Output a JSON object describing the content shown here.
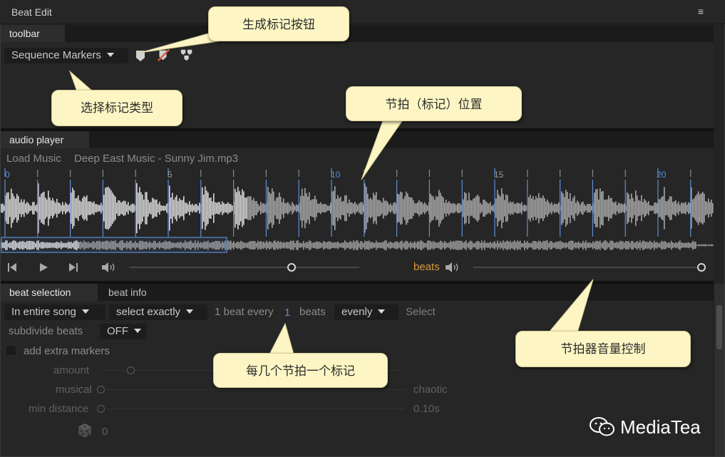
{
  "window": {
    "title": "Beat Edit",
    "menu_icon": "hamburger-icon"
  },
  "toolbar_panel": {
    "tab": "toolbar",
    "marker_type_value": "Sequence Markers",
    "buttons": [
      "marker-icon",
      "clear-markers-icon",
      "beat-edit-icon"
    ]
  },
  "audio_player": {
    "tab": "audio player",
    "load_music": "Load Music",
    "file_name": "Deep East Music - Sunny Jim.mp3",
    "ruler_labels": [
      "0",
      "5",
      "10",
      "15",
      "20"
    ],
    "beats_label": "beats"
  },
  "beat_selection": {
    "tabs": [
      "beat selection",
      "beat info"
    ],
    "scope_value": "In entire song",
    "mode_value": "select exactly",
    "every_prefix": "1 beat every",
    "every_value": "1",
    "every_suffix": "beats",
    "distribution_value": "evenly",
    "select_label": "Select",
    "subdivide_label": "subdivide beats",
    "subdivide_value": "OFF",
    "extra_markers_label": "add extra markers",
    "amount_label": "amount",
    "musical_label": "musical",
    "chaotic_label": "chaotic",
    "min_distance_label": "min distance",
    "min_distance_value": "0.10s",
    "seed_value": "0"
  },
  "callouts": {
    "generate_markers": "生成标记按钮",
    "select_marker_type": "选择标记类型",
    "beat_marker_position": "节拍（标记）位置",
    "metronome_volume": "节拍器音量控制",
    "every_n_beats": "每几个节拍一个标记"
  },
  "watermark": "MediaTea",
  "colors": {
    "accent_blue": "#5d8fd8",
    "accent_orange": "#d89a3a",
    "callout_bg": "#fdf6c4",
    "panel_bg": "#262626"
  }
}
